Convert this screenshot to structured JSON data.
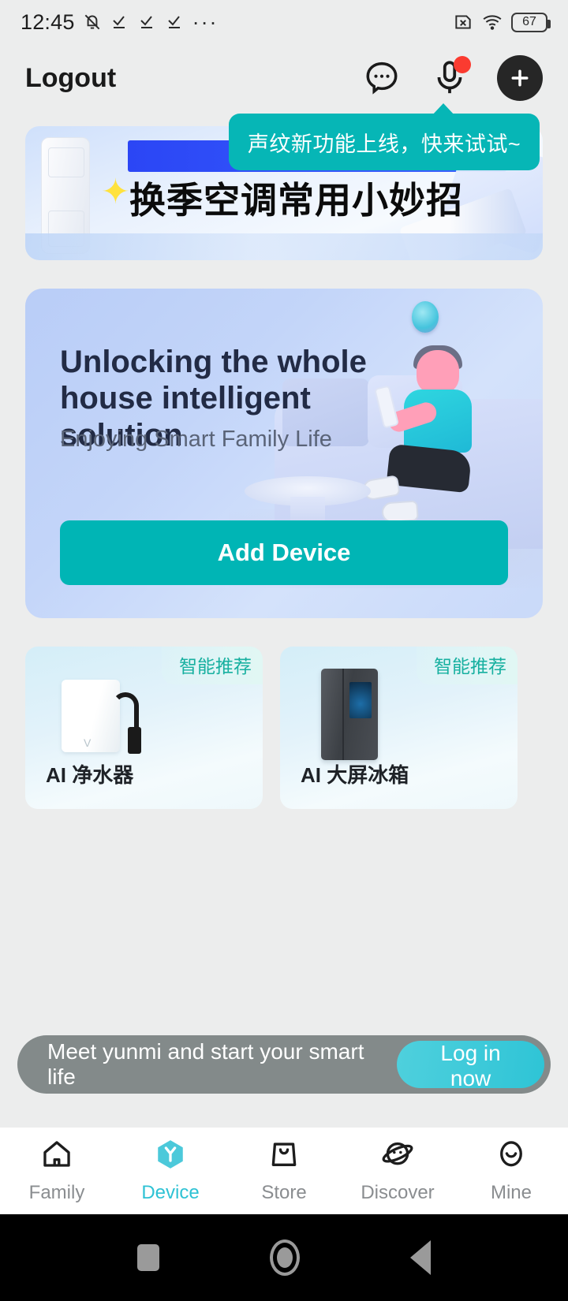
{
  "statusbar": {
    "time": "12:45",
    "icons": [
      "mute-bell-icon",
      "check-icon",
      "check-icon",
      "check-icon",
      "overflow-dots-icon"
    ],
    "sim_icon": "no-sim-icon",
    "wifi_icon": "wifi-icon",
    "battery_level": "67"
  },
  "header": {
    "title": "Logout",
    "chat_icon": "chat-bubble-icon",
    "mic_icon": "microphone-icon",
    "add_icon": "plus-icon"
  },
  "tooltip": {
    "text": "声纹新功能上线，快来试试~"
  },
  "banner": {
    "title": "换季空调常用小妙招"
  },
  "hero": {
    "title": "Unlocking the whole house intelligent solution",
    "subtitle": "Enjoying Smart Family Life",
    "cta_label": "Add Device"
  },
  "recommendations": [
    {
      "badge": "智能推荐",
      "name": "AI 净水器",
      "product_icon": "water-purifier-icon"
    },
    {
      "badge": "智能推荐",
      "name": "AI 大屏冰箱",
      "product_icon": "smart-fridge-icon"
    }
  ],
  "login_strip": {
    "message": "Meet yunmi and start your smart life",
    "button_label": "Log in now"
  },
  "tabbar": {
    "items": [
      {
        "label": "Family",
        "icon": "home-icon",
        "active": false
      },
      {
        "label": "Device",
        "icon": "device-shield-icon",
        "active": true
      },
      {
        "label": "Store",
        "icon": "shopping-bag-icon",
        "active": false
      },
      {
        "label": "Discover",
        "icon": "planet-icon",
        "active": false
      },
      {
        "label": "Mine",
        "icon": "smiley-face-icon",
        "active": false
      }
    ]
  },
  "sysnav": {
    "recents": "recents-square-icon",
    "home": "home-circle-icon",
    "back": "back-triangle-icon"
  },
  "colors": {
    "accent_teal": "#00b5b5",
    "tab_active": "#2ec2d4",
    "badge_red": "#fb3b30",
    "page_bg": "#eceded"
  }
}
